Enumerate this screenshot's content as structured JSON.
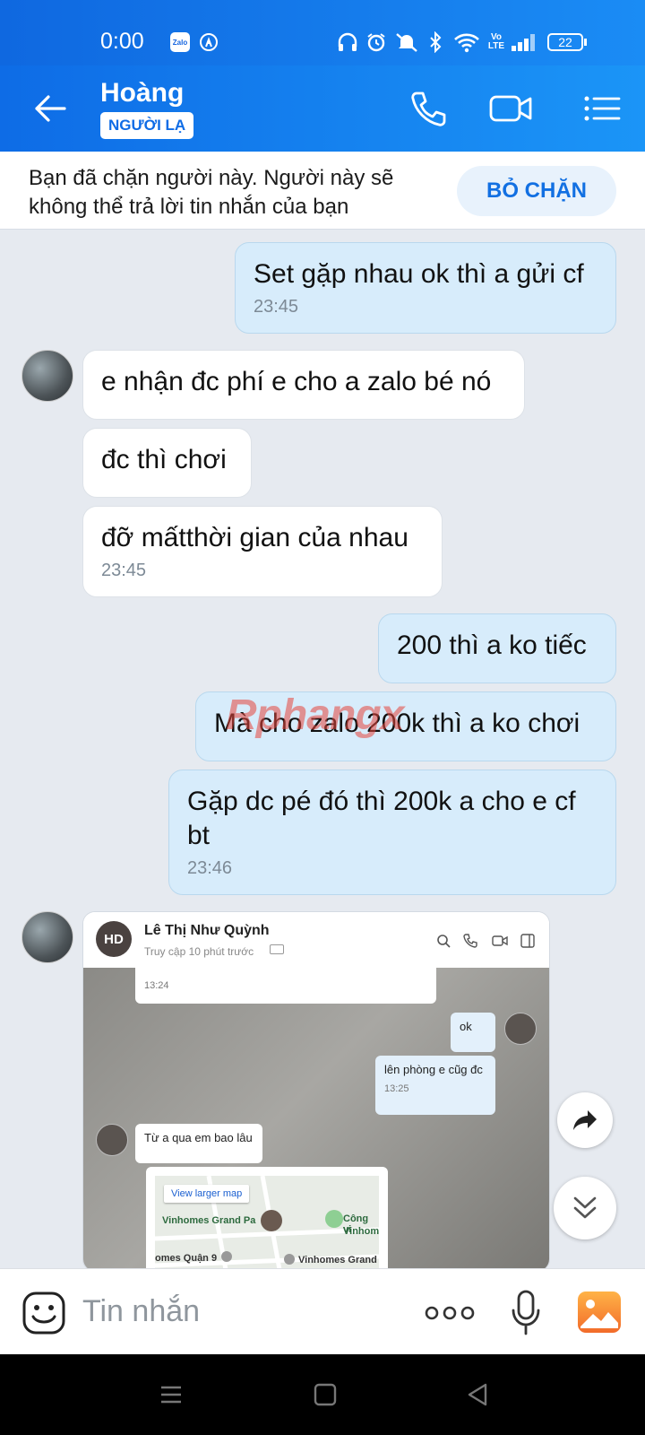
{
  "status_bar": {
    "time": "0:00",
    "battery": "22"
  },
  "header": {
    "contact_name": "Hoàng",
    "stranger_badge": "NGƯỜI LẠ"
  },
  "block_banner": {
    "text": "Bạn đã chặn người này. Người này sẽ không thể trả lời tin nhắn của bạn",
    "unblock_label": "BỎ CHẶN"
  },
  "messages": [
    {
      "dir": "out",
      "text": "Set gặp nhau ok thì a gửi cf",
      "time": "23:45"
    },
    {
      "dir": "in",
      "text": "e nhận đc phí e cho a zalo bé nó",
      "time": ""
    },
    {
      "dir": "in",
      "text": "đc thì chơi",
      "time": ""
    },
    {
      "dir": "in",
      "text": "đỡ mấtthời gian của nhau",
      "time": "23:45"
    },
    {
      "dir": "out",
      "text": "200 thì a ko tiếc",
      "time": ""
    },
    {
      "dir": "out",
      "text": "Mà cho zalo 200k thì a ko chơi",
      "time": ""
    },
    {
      "dir": "out",
      "text": "Gặp dc pé đó thì 200k a cho e cf bt",
      "time": "23:46"
    }
  ],
  "watermark": "Rphangx",
  "screenshot": {
    "avatar_label": "HD",
    "name": "Lê Thị Như Quỳnh",
    "status": "Truy cập 10 phút trước",
    "bubble_time_1": "13:24",
    "bubble_ok": "ok",
    "bubble_room": "lên phòng e cũg đc",
    "bubble_room_time": "13:25",
    "bubble_question": "Từ a qua em bao lâu",
    "map_link": "View larger map",
    "map_labels": [
      "Vinhomes Grand Pa",
      "Công vi",
      "Vinhom",
      "omes Quận 9",
      "Vinhomes Grand"
    ]
  },
  "input_bar": {
    "placeholder": "Tin nhắn"
  }
}
